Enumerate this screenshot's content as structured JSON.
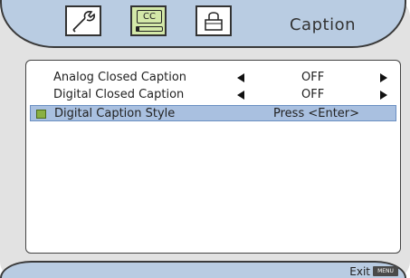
{
  "header": {
    "title": "Caption",
    "tabs": [
      {
        "icon": "wrench-icon"
      },
      {
        "icon": "closed-caption-icon",
        "label": "CC"
      },
      {
        "icon": "lock-icon"
      }
    ]
  },
  "menu": {
    "items": [
      {
        "label": "Analog Closed Caption",
        "value": "OFF"
      },
      {
        "label": "Digital Closed Caption",
        "value": "OFF"
      },
      {
        "label": "Digital Caption Style",
        "value": "Press <Enter>"
      }
    ]
  },
  "footer": {
    "exit_label": "Exit",
    "menu_key": "MENU"
  },
  "colors": {
    "header_bg": "#b9cce2",
    "selected_bg": "#a9c0e0",
    "active_tab": "#d3e8a8",
    "bullet": "#8ab042"
  }
}
